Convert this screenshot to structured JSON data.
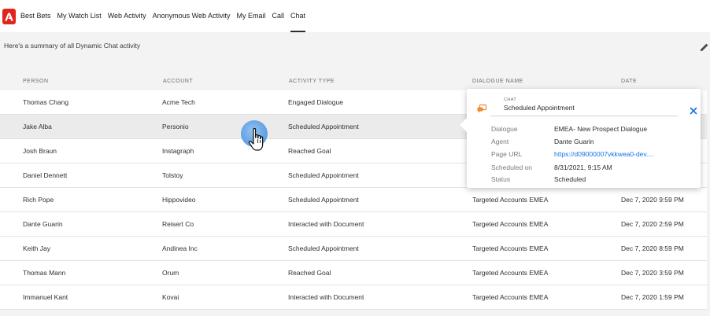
{
  "nav": {
    "tabs": [
      {
        "label": "Best Bets",
        "active": false
      },
      {
        "label": "My Watch List",
        "active": false
      },
      {
        "label": "Web Activity",
        "active": false
      },
      {
        "label": "Anonymous Web Activity",
        "active": false
      },
      {
        "label": "My Email",
        "active": false
      },
      {
        "label": "Call",
        "active": false
      },
      {
        "label": "Chat",
        "active": true
      }
    ]
  },
  "summary": "Here's a summary of all Dynamic Chat activity",
  "table": {
    "headers": {
      "person": "PERSON",
      "account": "ACCOUNT",
      "activity": "ACTIVITY TYPE",
      "dialogue": "DIALOGUE NAME",
      "date": "DATE"
    },
    "rows": [
      {
        "person": "Thomas Chang",
        "account": "Acme Tech",
        "activity": "Engaged Dialogue",
        "dialogue": "",
        "date": ""
      },
      {
        "person": "Jake Alba",
        "account": "Personio",
        "activity": "Scheduled Appointment",
        "dialogue": "",
        "date": ""
      },
      {
        "person": "Josh Braun",
        "account": "Instagraph",
        "activity": "Reached Goal",
        "dialogue": "",
        "date": ""
      },
      {
        "person": "Daniel Dennett",
        "account": "Tolstoy",
        "activity": "Scheduled Appointment",
        "dialogue": "",
        "date": ""
      },
      {
        "person": "Rich Pope",
        "account": "Hippovideo",
        "activity": "Scheduled Appointment",
        "dialogue": "Targeted Accounts EMEA",
        "date": "Dec 7, 2020 9:59 PM"
      },
      {
        "person": "Dante Guarin",
        "account": "Reisert Co",
        "activity": "Interacted with Document",
        "dialogue": "Targeted Accounts EMEA",
        "date": "Dec 7, 2020 2:59 PM"
      },
      {
        "person": "Keith Jay",
        "account": "Andinea Inc",
        "activity": "Scheduled Appointment",
        "dialogue": "Targeted Accounts EMEA",
        "date": "Dec 7, 2020 8:59 PM"
      },
      {
        "person": "Thomas Mann",
        "account": "Orum",
        "activity": "Reached Goal",
        "dialogue": "Targeted Accounts EMEA",
        "date": "Dec 7, 2020 3:59 PM"
      },
      {
        "person": "Immanuel Kant",
        "account": "Kovai",
        "activity": "Interacted with Document",
        "dialogue": "Targeted Accounts EMEA",
        "date": "Dec 7, 2020 1:59 PM"
      }
    ]
  },
  "popover": {
    "small_label": "CHAT",
    "title": "Scheduled Appointment",
    "fields": [
      {
        "label": "Dialogue",
        "value": "EMEA- New Prospect Dialogue"
      },
      {
        "label": "Agent",
        "value": "Dante Guarin"
      },
      {
        "label": "Page URL",
        "value": "https://d09000007vkkwea0-dev...."
      },
      {
        "label": "Scheduled on",
        "value": "8/31/2021, 9:15 AM"
      },
      {
        "label": "Status",
        "value": "Scheduled"
      }
    ]
  },
  "icons": {
    "logo": "adobe-logo-icon",
    "edit": "pencil-icon",
    "chat": "chat-icon",
    "close": "close-icon",
    "cursor": "hand-pointer-icon"
  },
  "colors": {
    "brand": "#e1251b",
    "link": "#1473e6",
    "highlight_row": "#ebebeb",
    "band": "#f3f3f3",
    "cursor_circle": "#5a9ee4"
  }
}
